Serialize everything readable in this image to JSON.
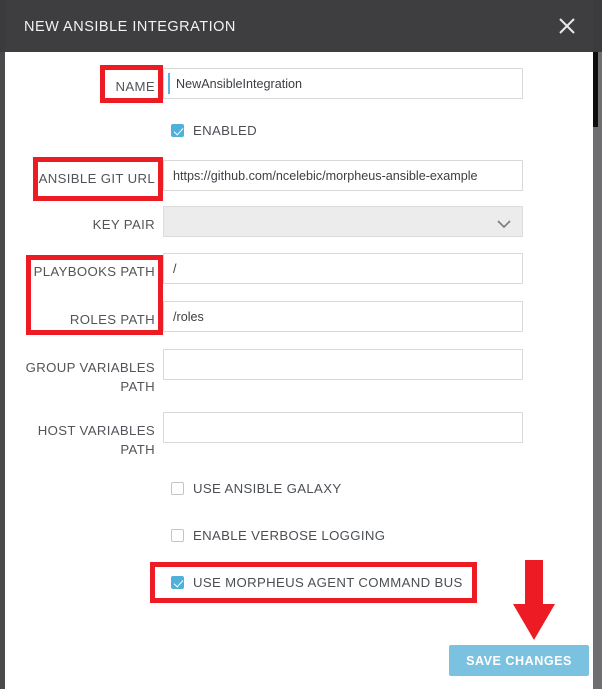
{
  "window": {
    "title": "NEW ANSIBLE INTEGRATION",
    "close_icon": "close-icon",
    "header_bg": "#3e3e40"
  },
  "form": {
    "name": {
      "label": "NAME",
      "value": "NewAnsibleIntegration",
      "placeholder": ""
    },
    "enabled": {
      "label": "ENABLED",
      "checked": true
    },
    "git_url": {
      "label": "ANSIBLE GIT URL",
      "value": "https://github.com/ncelebic/morpheus-ansible-example",
      "placeholder": ""
    },
    "key_pair": {
      "label": "KEY PAIR",
      "value": "",
      "chevron_icon": "chevron-down-icon"
    },
    "playbooks_path": {
      "label": "PLAYBOOKS PATH",
      "value": "/",
      "placeholder": ""
    },
    "roles_path": {
      "label": "ROLES PATH",
      "value": "/roles",
      "placeholder": ""
    },
    "group_variables_path": {
      "label": "GROUP VARIABLES\nPATH",
      "value": "",
      "placeholder": ""
    },
    "host_variables_path": {
      "label": "HOST VARIABLES\nPATH",
      "value": "",
      "placeholder": ""
    },
    "use_ansible_galaxy": {
      "label": "USE ANSIBLE GALAXY",
      "checked": false
    },
    "enable_verbose_logging": {
      "label": "ENABLE VERBOSE LOGGING",
      "checked": false
    },
    "use_command_bus": {
      "label": "USE MORPHEUS AGENT COMMAND BUS",
      "checked": true
    }
  },
  "footer": {
    "save_label": "SAVE CHANGES",
    "save_color": "#7ac2e0"
  },
  "annotations": {
    "highlight_color": "#ed1c24",
    "boxes": [
      "name-label",
      "ansible-git-url-label",
      "playbooks-and-roles-path-labels",
      "use-morpheus-agent-command-bus-checkbox"
    ],
    "arrow": "points-to-save-changes-button"
  }
}
